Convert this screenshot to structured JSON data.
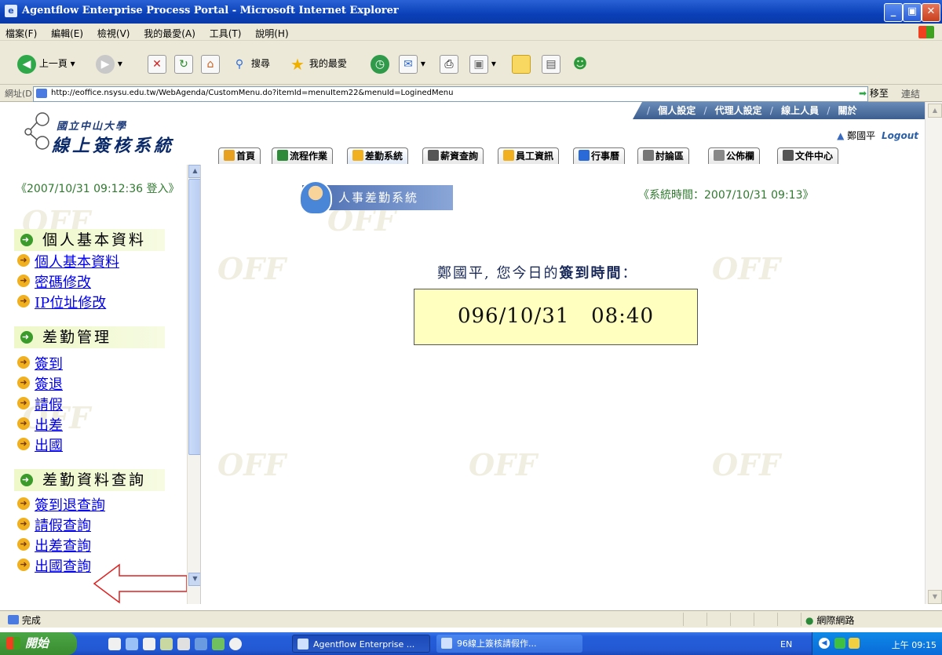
{
  "window": {
    "title": "Agentflow Enterprise Process Portal - Microsoft Internet Explorer",
    "minimize": "_",
    "maximize": "▣",
    "close": "✕"
  },
  "menubar": [
    "檔案(F)",
    "編輯(E)",
    "檢視(V)",
    "我的最愛(A)",
    "工具(T)",
    "說明(H)"
  ],
  "toolbar": {
    "back": "上一頁",
    "search": "搜尋",
    "favorites": "我的最愛"
  },
  "address": {
    "label": "網址(D)",
    "url": "http://eoffice.nsysu.edu.tw/WebAgenda/CustomMenu.do?itemId=menuItem22&menuId=LoginedMenu",
    "go": "移至",
    "links": "連結"
  },
  "header": {
    "school": "國立中山大學",
    "system": "線上簽核系統",
    "topnav": [
      "個人設定",
      "代理人設定",
      "線上人員",
      "關於"
    ],
    "user": "鄭國平",
    "logout": "Logout",
    "tabs": [
      "首頁",
      "流程作業",
      "差勤系統",
      "薪資查詢",
      "員工資訊",
      "行事曆",
      "討論區",
      "公佈欄",
      "文件中心"
    ]
  },
  "sidebar": {
    "login_info": "《2007/10/31 09:12:36 登入》",
    "sections": [
      {
        "title": "個人基本資料",
        "links": [
          "個人基本資料",
          "密碼修改",
          "IP位址修改"
        ]
      },
      {
        "title": "差勤管理",
        "links": [
          "簽到",
          "簽退",
          "請假",
          "出差",
          "出國"
        ]
      },
      {
        "title": "差勤資料查詢",
        "links": [
          "簽到退查詢",
          "請假查詢",
          "出差查詢",
          "出國查詢"
        ]
      }
    ]
  },
  "main": {
    "banner": "人事差勤系統",
    "system_time": "《系統時間：2007/10/31 09:13》",
    "greeting_prefix": "鄭國平, 您今日的",
    "greeting_emph": "簽到時間",
    "greeting_suffix": "：",
    "signin_time": "096/10/31   08:40",
    "watermark": "OFF"
  },
  "statusbar": {
    "status": "完成",
    "zone": "網際網路"
  },
  "taskbar": {
    "start": "開始",
    "items": [
      "Agentflow Enterprise ...",
      "96線上簽核請假作..."
    ],
    "lang": "EN",
    "clock": "上午 09:15"
  },
  "colors": {
    "accent": "#3c5e90",
    "link": "#0000ee",
    "timebox": "#ffffc0",
    "arrow": "#e02020"
  }
}
